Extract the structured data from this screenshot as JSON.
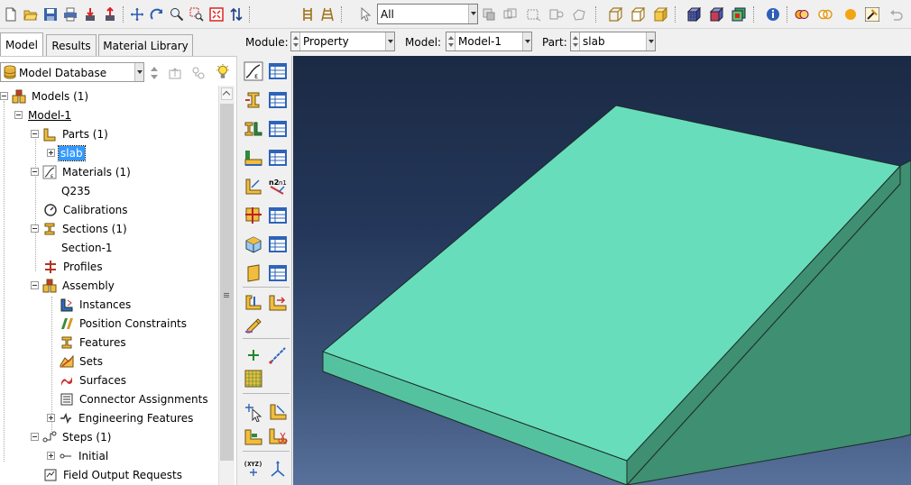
{
  "toolbar": {
    "selection_filter_value": "All"
  },
  "tabs": [
    {
      "label": "Model"
    },
    {
      "label": "Results"
    },
    {
      "label": "Material Library"
    }
  ],
  "context_bar": {
    "module_label": "Module:",
    "module_value": "Property",
    "model_label": "Model:",
    "model_value": "Model-1",
    "part_label": "Part:",
    "part_value": "slab"
  },
  "model_tree": {
    "database_combo": "Model Database",
    "nodes": [
      {
        "label": "Models (1)",
        "icon": "models-icon"
      },
      {
        "label": "Model-1",
        "icon": ""
      },
      {
        "label": "Parts (1)",
        "icon": "parts-icon"
      },
      {
        "label": "slab",
        "icon": ""
      },
      {
        "label": "Materials (1)",
        "icon": "materials-icon"
      },
      {
        "label": "Q235",
        "icon": ""
      },
      {
        "label": "Calibrations",
        "icon": "calibrations-icon"
      },
      {
        "label": "Sections (1)",
        "icon": "sections-icon"
      },
      {
        "label": "Section-1",
        "icon": ""
      },
      {
        "label": "Profiles",
        "icon": "profiles-icon"
      },
      {
        "label": "Assembly",
        "icon": "assembly-icon"
      },
      {
        "label": "Instances",
        "icon": "instances-icon"
      },
      {
        "label": "Position Constraints",
        "icon": "position-constraints-icon"
      },
      {
        "label": "Features",
        "icon": "features-icon"
      },
      {
        "label": "Sets",
        "icon": "sets-icon"
      },
      {
        "label": "Surfaces",
        "icon": "surfaces-icon"
      },
      {
        "label": "Connector Assignments",
        "icon": "connector-assignments-icon"
      },
      {
        "label": "Engineering Features",
        "icon": "engineering-features-icon"
      },
      {
        "label": "Steps (1)",
        "icon": "steps-icon"
      },
      {
        "label": "Initial",
        "icon": "initial-step-icon"
      },
      {
        "label": "Field Output Requests",
        "icon": "field-output-icon"
      }
    ]
  },
  "colors": {
    "part_top": "#68ddbc",
    "part_front": "#55c29f",
    "part_side": "#3f8f72",
    "viewport_top": "#1b2a44",
    "viewport_bottom": "#58719b",
    "selection": "#3399ff"
  }
}
